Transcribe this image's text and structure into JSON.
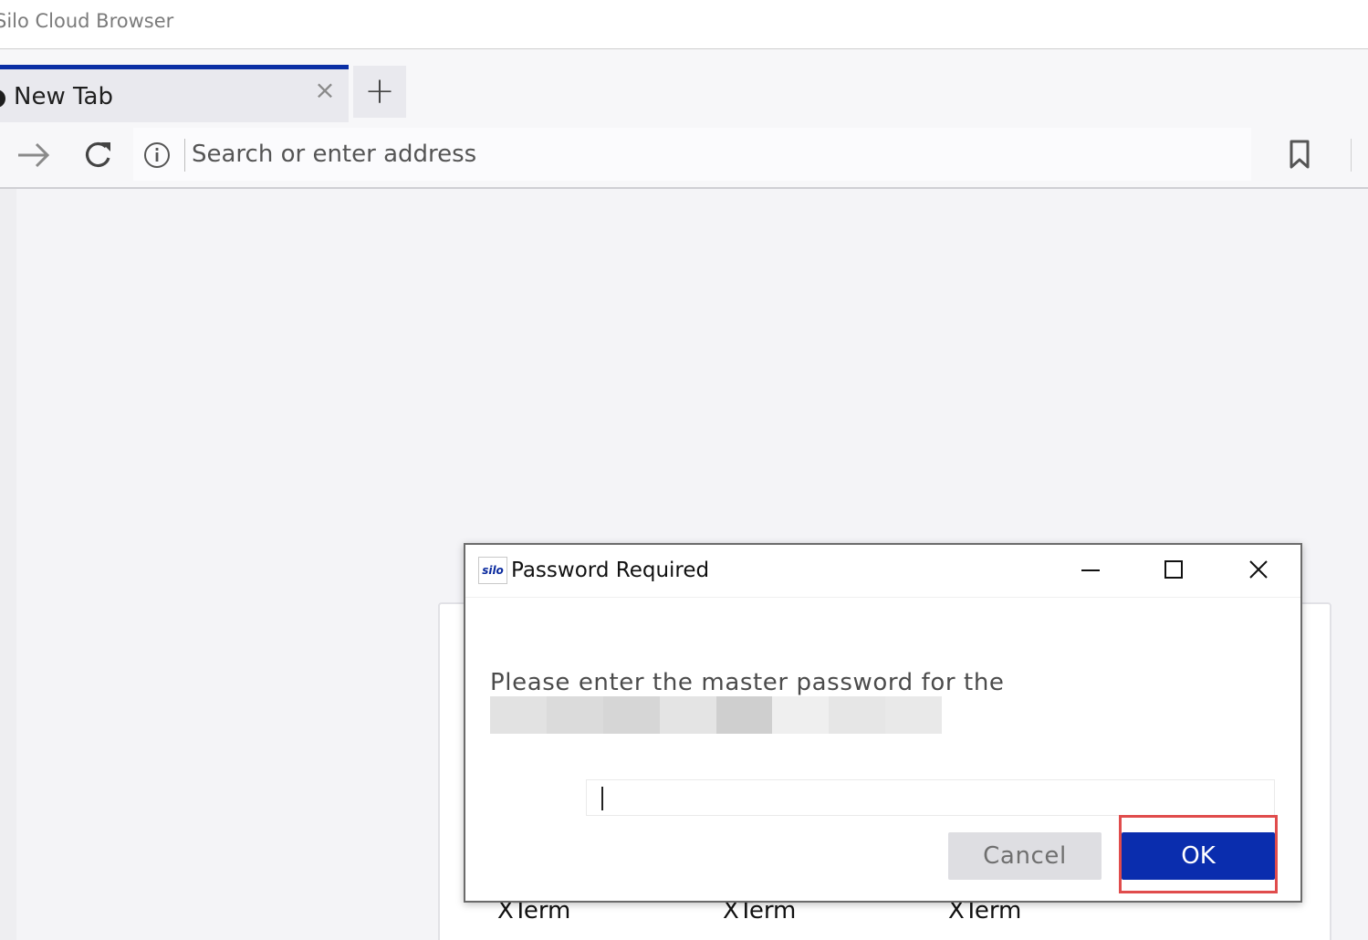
{
  "window": {
    "title": "Silo Cloud Browser"
  },
  "tabs": [
    {
      "label": "New Tab",
      "active": true
    }
  ],
  "new_tab_label": "+",
  "navbar": {
    "address_placeholder": "Search or enter address"
  },
  "background": {
    "apps": [
      "XTerm",
      "XTerm",
      "XTerm"
    ]
  },
  "dialog": {
    "logo_text": "silo",
    "title": "Password Required",
    "message": "Please enter the master password for the",
    "password_value": "",
    "cancel_label": "Cancel",
    "ok_label": "OK",
    "highlighted_button": "ok"
  },
  "colors": {
    "accent": "#0b2fa5",
    "ok_button": "#0a2dae",
    "highlight": "#e04c4c",
    "cancel_button": "#dedee2"
  },
  "icons": [
    "forward-arrow-icon",
    "reload-icon",
    "info-icon",
    "bookmark-icon",
    "minimize-icon",
    "maximize-icon",
    "close-icon"
  ]
}
